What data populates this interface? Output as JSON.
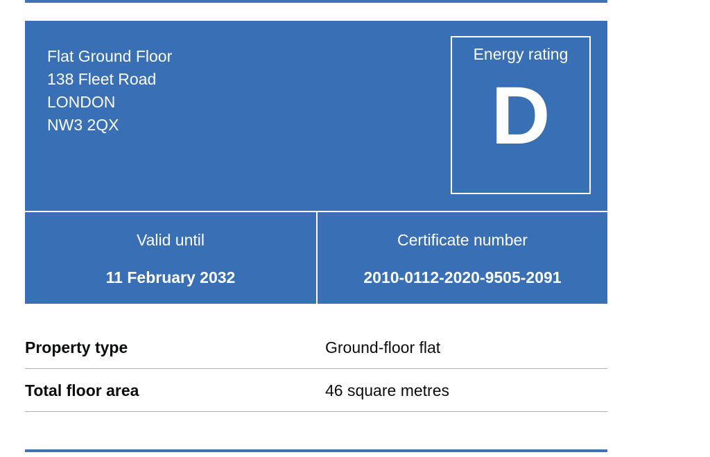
{
  "address": {
    "line1": "Flat Ground Floor",
    "line2": "138 Fleet Road",
    "line3": "LONDON",
    "postcode": "NW3 2QX"
  },
  "energy_rating": {
    "label": "Energy rating",
    "value": "D"
  },
  "validity": {
    "label": "Valid until",
    "value": "11 February 2032"
  },
  "certificate": {
    "label": "Certificate number",
    "value": "2010-0112-2020-9505-2091"
  },
  "details": [
    {
      "key": "Property type",
      "value": "Ground-floor flat"
    },
    {
      "key": "Total floor area",
      "value": "46 square metres"
    }
  ],
  "colors": {
    "summary_background": "#3970b5",
    "text_on_blue": "#ffffff",
    "rule": "#3f74b6",
    "row_border": "#b1b4b6"
  }
}
